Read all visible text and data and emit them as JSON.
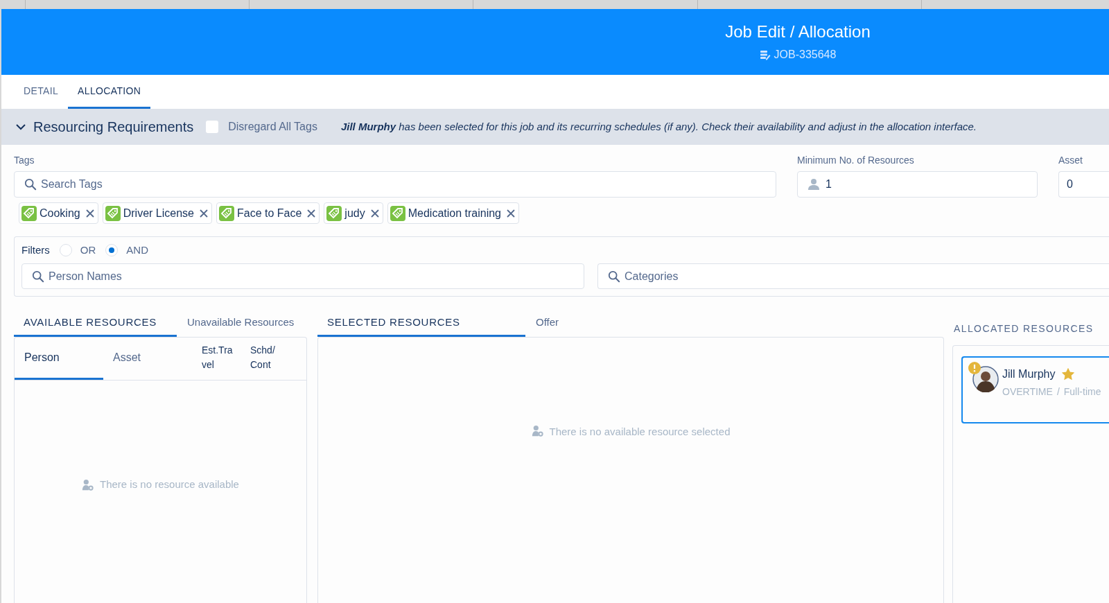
{
  "header": {
    "title": "Job Edit / Allocation",
    "job_number": "JOB-335648"
  },
  "tabs": [
    {
      "label": "DETAIL",
      "selected": false
    },
    {
      "label": "ALLOCATION",
      "selected": true
    }
  ],
  "section": {
    "title": "Resourcing Requirements",
    "expanded": true,
    "disregard_all_tags": {
      "label": "Disregard All Tags",
      "checked": false
    },
    "message": "**Jill Murphy** has been selected for this job and its recurring schedules (if any). Check their availability and adjust in the allocation interface."
  },
  "tags": {
    "label": "Tags",
    "placeholder": "Search Tags",
    "items": [
      {
        "label": "Cooking"
      },
      {
        "label": "Driver License"
      },
      {
        "label": "Face to Face"
      },
      {
        "label": "judy"
      },
      {
        "label": "Medication training"
      }
    ]
  },
  "minimum_resources": {
    "label": "Minimum No. of Resources",
    "value": "1"
  },
  "asset": {
    "label": "Asset",
    "value": "0"
  },
  "filters": {
    "label": "Filters",
    "options": [
      {
        "label": "OR",
        "selected": false
      },
      {
        "label": "AND",
        "selected": true
      }
    ],
    "person_names_placeholder": "Person Names",
    "categories_placeholder": "Categories"
  },
  "resource_tabs": [
    {
      "label": "AVAILABLE RESOURCES",
      "selected": true
    },
    {
      "label": "Unavailable Resources",
      "selected": false
    }
  ],
  "selected_tabs": [
    {
      "label": "SELECTED RESOURCES",
      "selected": true
    },
    {
      "label": "Offer",
      "selected": false
    }
  ],
  "available_columns": [
    {
      "label": "Person",
      "selected": true
    },
    {
      "label": "Asset",
      "selected": false
    },
    {
      "label": "Est.Travel",
      "selected": false
    },
    {
      "label": "Schd/ Cont",
      "selected": false
    }
  ],
  "available_empty": "There is no resource available",
  "selected_empty": "There is no available resource selected",
  "allocated": {
    "title": "ALLOCATED RESOURCES",
    "items": [
      {
        "name": "Jill Murphy",
        "status": "OVERTIME",
        "separator": "/",
        "employment": "Full-time",
        "warning": true,
        "starred": true,
        "selected": true
      }
    ]
  }
}
